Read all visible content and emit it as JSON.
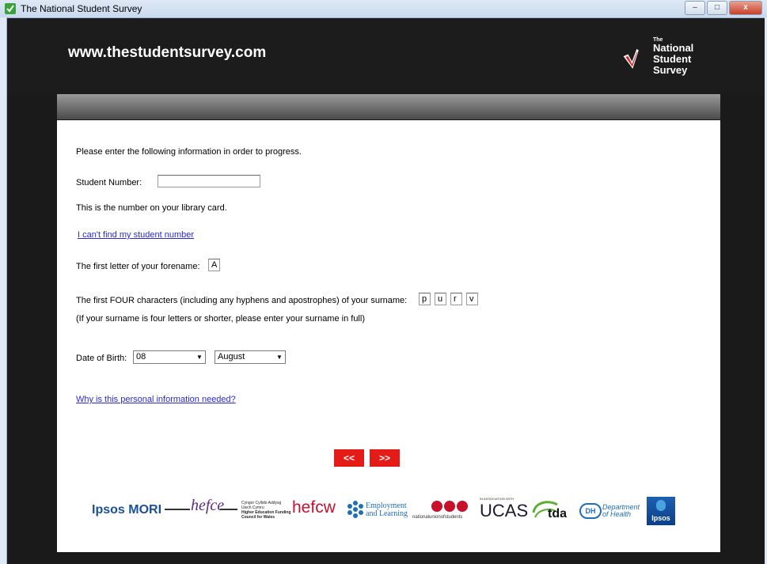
{
  "window": {
    "title": "The National Student Survey"
  },
  "header": {
    "site_url": "www.thestudentsurvey.com",
    "logo": {
      "line0": "The",
      "line1": "National",
      "line2": "Student",
      "line3": "Survey"
    }
  },
  "form": {
    "intro": "Please enter the following information in order to progress.",
    "student_number_label": "Student Number:",
    "student_number_value": "",
    "student_number_help": "This is the number on your library card.",
    "cant_find_link": "I can't find my student number",
    "forename_label": "The first letter of your forename:",
    "forename_value": "A",
    "surname_label": "The first FOUR characters (including any hyphens and apostrophes) of your surname:",
    "surname_chars": [
      "p",
      "u",
      "r",
      "v"
    ],
    "surname_note": "(If your surname is four letters or shorter, please enter your surname in full)",
    "dob_label": "Date of Birth:",
    "dob_day": "08",
    "dob_month": "August",
    "why_link": "Why is this personal information needed?"
  },
  "nav": {
    "back_label": "<<",
    "next_label": ">>"
  },
  "sponsors": {
    "ipsos_mori": "Ipsos MORI",
    "hefce": "hefce",
    "hefcw_welsh_1": "Cyngor Cyllido Addysg",
    "hefcw_welsh_2": "Uwch Cymru",
    "hefcw_english_1": "Higher Education Funding",
    "hefcw_english_2": "Council for Wales",
    "hefcw": "hefcw",
    "del_1": "Employment",
    "del_2": "and Learning",
    "nus": "nationalunionofstudents",
    "ucas_assoc": "IN ASSOCIATION WITH",
    "ucas": "UCAS",
    "tda": "tda",
    "dh_badge": "DH",
    "dh_1": "Department",
    "dh_2": "of Health",
    "ipsos": "Ipsos"
  },
  "colors": {
    "accent_red": "#e41b17",
    "link": "#2a2ad0"
  }
}
